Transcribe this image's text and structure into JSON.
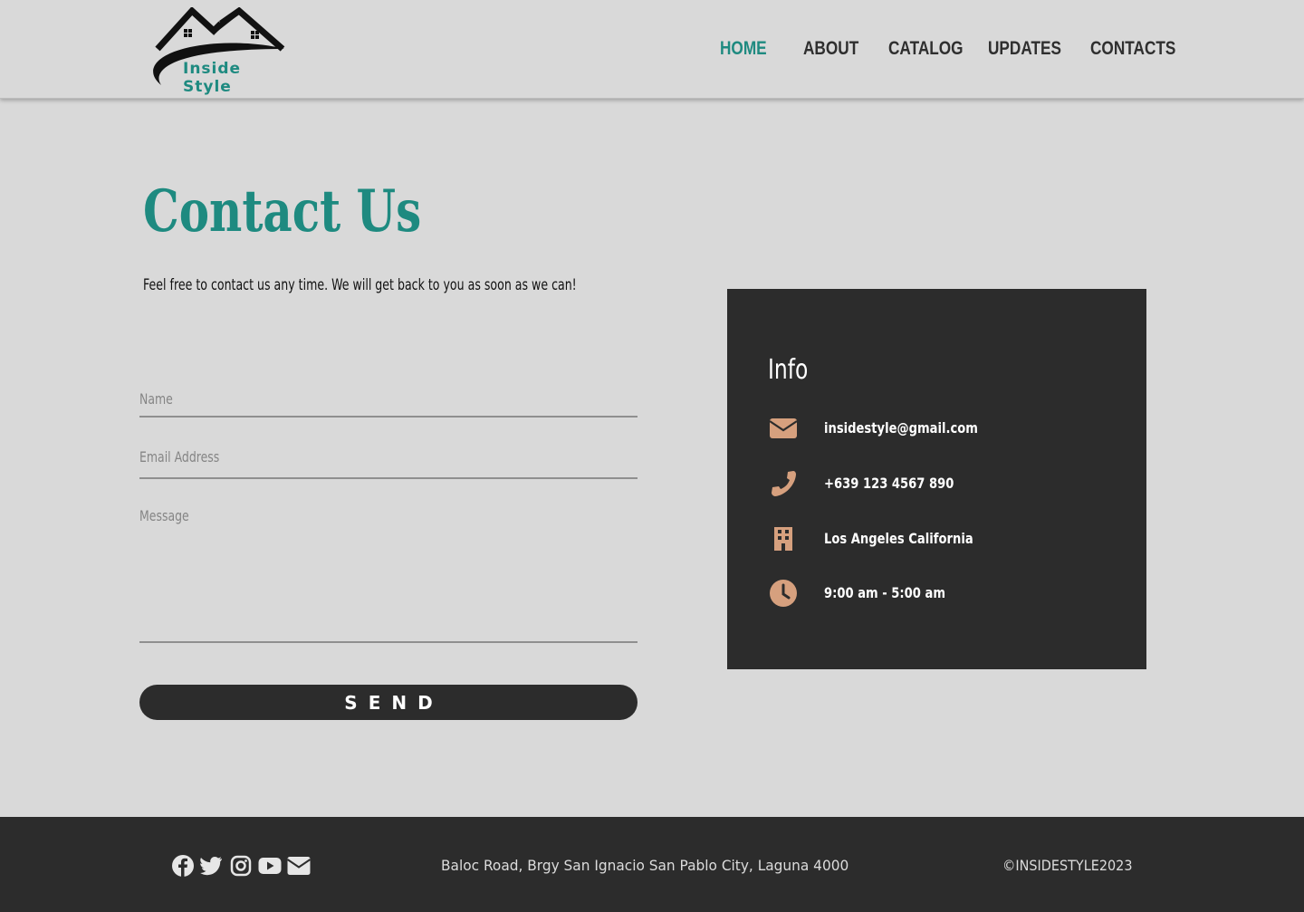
{
  "brand": {
    "logo_text": "Inside Style",
    "accent_color": "#1e8a80",
    "dark_color": "#2c2c2c",
    "icon_color": "#d6a07e"
  },
  "nav": {
    "items": [
      {
        "label": "HOME",
        "active": true
      },
      {
        "label": "ABOUT",
        "active": false
      },
      {
        "label": "CATALOG",
        "active": false
      },
      {
        "label": "UPDATES",
        "active": false
      },
      {
        "label": "CONTACTS",
        "active": false
      }
    ]
  },
  "main": {
    "title": "Contact Us",
    "subtitle": "Feel free to contact us any time. We will get back to you as soon as we can!",
    "form": {
      "name_placeholder": "Name",
      "email_placeholder": "Email Address",
      "message_placeholder": "Message",
      "send_label": "SEND"
    }
  },
  "info": {
    "title": "Info",
    "items": [
      {
        "icon": "envelope-icon",
        "text": "insidestyle@gmail.com"
      },
      {
        "icon": "phone-icon",
        "text": "+639 123 4567 890"
      },
      {
        "icon": "building-icon",
        "text": "Los Angeles California"
      },
      {
        "icon": "clock-icon",
        "text": "9:00 am - 5:00 am"
      }
    ]
  },
  "footer": {
    "social": [
      "facebook-icon",
      "twitter-icon",
      "instagram-icon",
      "youtube-icon",
      "envelope-icon"
    ],
    "address": "Baloc Road, Brgy San Ignacio San Pablo City, Laguna 4000",
    "copyright": "©INSIDESTYLE2023"
  }
}
